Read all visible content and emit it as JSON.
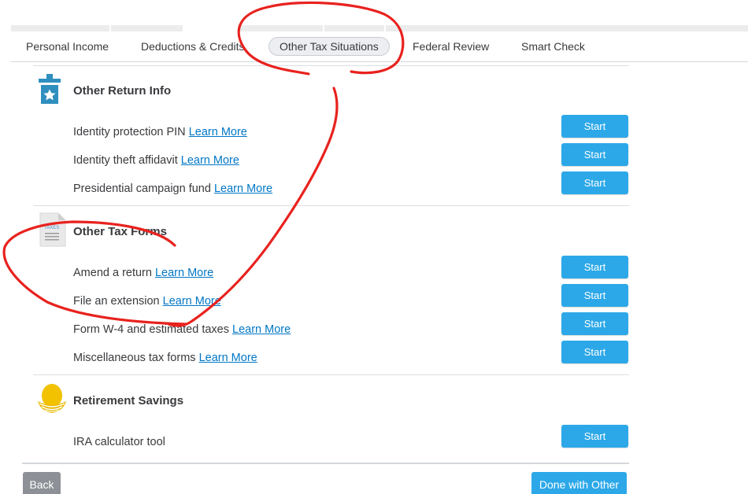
{
  "tabs": [
    {
      "label": "Personal Income"
    },
    {
      "label": "Deductions & Credits"
    },
    {
      "label": "Other Tax Situations"
    },
    {
      "label": "Federal Review"
    },
    {
      "label": "Smart Check"
    }
  ],
  "active_tab": "Other Tax Situations",
  "sections": [
    {
      "title": "Other Return Info",
      "icon": "ballot-box-star-icon",
      "rows": [
        {
          "label": "Identity protection PIN",
          "link": "Learn More",
          "button": "Start"
        },
        {
          "label": "Identity theft affidavit",
          "link": "Learn More",
          "button": "Start"
        },
        {
          "label": "Presidential campaign fund",
          "link": "Learn More",
          "button": "Start"
        }
      ]
    },
    {
      "title": "Other Tax Forms",
      "icon": "tax-document-icon",
      "icon_text": "TAXES",
      "rows": [
        {
          "label": "Amend a return",
          "link": "Learn More",
          "button": "Start"
        },
        {
          "label": "File an extension",
          "link": "Learn More",
          "button": "Start"
        },
        {
          "label": "Form W-4 and estimated taxes",
          "link": "Learn More",
          "button": "Start"
        },
        {
          "label": "Miscellaneous tax forms",
          "link": "Learn More",
          "button": "Start"
        }
      ]
    },
    {
      "title": "Retirement Savings",
      "icon": "nest-egg-icon",
      "rows": [
        {
          "label": "IRA calculator tool",
          "button": "Start"
        }
      ]
    }
  ],
  "footer": {
    "back_label": "Back",
    "done_label": "Done with Other"
  },
  "colors": {
    "accent": "#2ca8e8",
    "link": "#0077c5",
    "back_button": "#8d9096",
    "annotation": "#e8221e"
  }
}
